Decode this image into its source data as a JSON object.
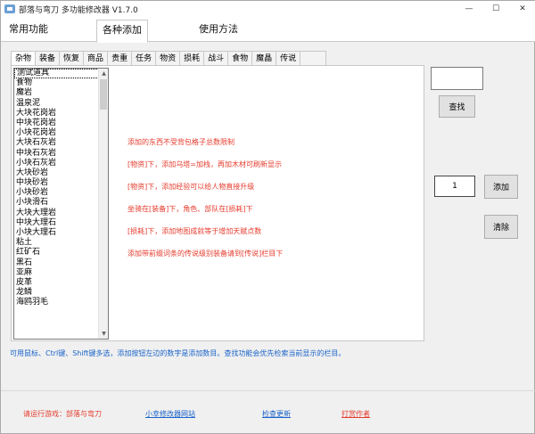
{
  "window": {
    "title": "部落与弯刀  多功能修改器  V1.7.0",
    "controls": [
      "—",
      "☐",
      "✕"
    ]
  },
  "top_tabs": [
    {
      "label": "常用功能"
    },
    {
      "label": "各种添加"
    },
    {
      "label": "使用方法"
    }
  ],
  "sub_tabs": [
    "杂物",
    "装备",
    "恢复",
    "商品",
    "贵重",
    "任务",
    "物资",
    "损耗",
    "战斗",
    "食物",
    "魔晶",
    "传说"
  ],
  "items": [
    "测试道具",
    "食物",
    "魔岩",
    "温泉泥",
    "大块花岗岩",
    "中块花岗岩",
    "小块花岗岩",
    "大块石灰岩",
    "中块石灰岩",
    "小块石灰岩",
    "大块砂岩",
    "中块砂岩",
    "小块砂岩",
    "小块滑石",
    "大块大理岩",
    "中块大理石",
    "小块大理石",
    "粘土",
    "红矿石",
    "黑石",
    "亚麻",
    "皮革",
    "龙鳞",
    "海鸥羽毛"
  ],
  "notes": [
    "添加的东西不受背包格子总数限制",
    "[物资]下，添加乌塔=加栈，再加木材可刷新显示",
    "[物资]下，添加经验可以给人物直接升级",
    "坐骑在[装备]下，角色、部队在[损耗]下",
    "[损耗]下，添加地图成就等于增加天赋点数",
    "添加带前缀词条的传说级别装备请到[传说]栏目下"
  ],
  "search": {
    "value": "",
    "button": "查找"
  },
  "quantity": {
    "value": "1",
    "add_button": "添加"
  },
  "clear_button": "清除",
  "hint": "可用鼠标、Ctrl键、Shift键多选，添加按钮左边的数字是添加数目。查找功能会优先检索当前显示的栏目。",
  "footer": {
    "game_prompt": "请运行游戏：部落与弯刀",
    "site_link": "小幸修改器网站",
    "update_link": "检查更新",
    "donate_link": "打赏作者"
  },
  "colors": {
    "note_red": "#e53b2c",
    "link_blue": "#1a63c8"
  }
}
